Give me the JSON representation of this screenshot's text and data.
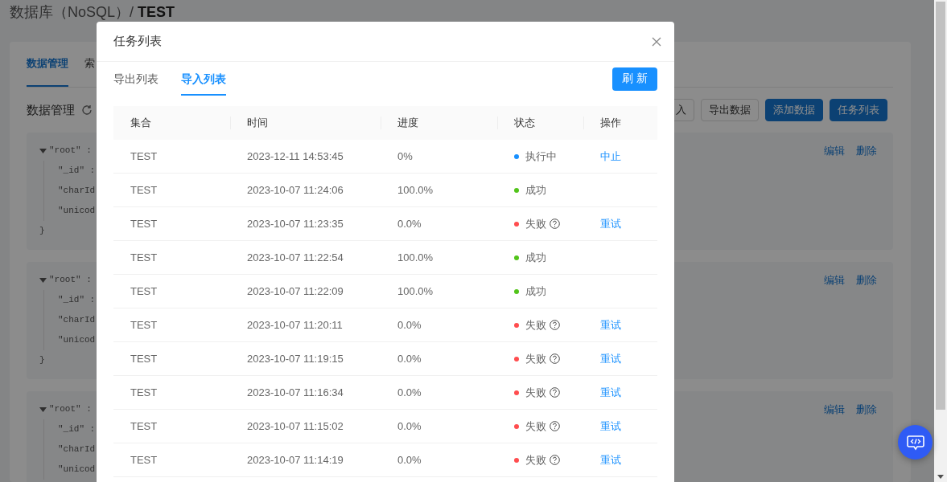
{
  "page": {
    "breadcrumb": "数据库（NoSQL）/ **TEST**",
    "tabs": [
      {
        "label": "数据管理",
        "selected": true
      },
      {
        "label": "索",
        "selected": false
      }
    ],
    "section_title": "数据管理",
    "toolbar_buttons": [
      {
        "label": "入",
        "kind": "default"
      },
      {
        "label": "导出数据",
        "kind": "default"
      },
      {
        "label": "添加数据",
        "kind": "primary"
      },
      {
        "label": "任务列表",
        "kind": "primary"
      }
    ],
    "records": [
      {
        "root": "\"root\" :",
        "expanded": true,
        "fields": [
          "\"_id\" :",
          "\"charId",
          "\"unicod"
        ],
        "closing": "}",
        "actions": [
          "编辑",
          "删除"
        ]
      },
      {
        "root": "\"root\" :",
        "expanded": true,
        "fields": [
          "\"_id\" :",
          "\"charId",
          "\"unicod"
        ],
        "closing": "}",
        "actions": [
          "编辑",
          "删除"
        ]
      },
      {
        "root": "\"root\" :",
        "expanded": true,
        "fields": [
          "\"_id\" :",
          "\"charId",
          "\"unicod"
        ],
        "actions": [
          "编辑",
          "删除"
        ]
      }
    ]
  },
  "dialog": {
    "title": "任务列表",
    "tabs": [
      {
        "label": "导出列表",
        "selected": false
      },
      {
        "label": "导入列表",
        "selected": true
      }
    ],
    "refresh_button": "刷 新",
    "table": {
      "columns": [
        "集合",
        "时间",
        "进度",
        "状态",
        "操作"
      ],
      "rows": [
        {
          "collection": "TEST",
          "time": "2023-12-11 14:53:45",
          "progress": "0%",
          "status": {
            "text": "执行中",
            "kind": "running",
            "color": "#1890ff"
          },
          "action": "中止"
        },
        {
          "collection": "TEST",
          "time": "2023-10-07 11:24:06",
          "progress": "100.0%",
          "status": {
            "text": "成功",
            "kind": "success",
            "color": "#52c41a"
          }
        },
        {
          "collection": "TEST",
          "time": "2023-10-07 11:23:35",
          "progress": "0.0%",
          "status": {
            "text": "失败",
            "kind": "failed",
            "color": "#ff4d4f"
          },
          "action": "重试"
        },
        {
          "collection": "TEST",
          "time": "2023-10-07 11:22:54",
          "progress": "100.0%",
          "status": {
            "text": "成功",
            "kind": "success",
            "color": "#52c41a"
          }
        },
        {
          "collection": "TEST",
          "time": "2023-10-07 11:22:09",
          "progress": "100.0%",
          "status": {
            "text": "成功",
            "kind": "success",
            "color": "#52c41a"
          }
        },
        {
          "collection": "TEST",
          "time": "2023-10-07 11:20:11",
          "progress": "0.0%",
          "status": {
            "text": "失败",
            "kind": "failed",
            "color": "#ff4d4f"
          },
          "action": "重试"
        },
        {
          "collection": "TEST",
          "time": "2023-10-07 11:19:15",
          "progress": "0.0%",
          "status": {
            "text": "失败",
            "kind": "failed",
            "color": "#ff4d4f"
          },
          "action": "重试"
        },
        {
          "collection": "TEST",
          "time": "2023-10-07 11:16:34",
          "progress": "0.0%",
          "status": {
            "text": "失败",
            "kind": "failed",
            "color": "#ff4d4f"
          },
          "action": "重试"
        },
        {
          "collection": "TEST",
          "time": "2023-10-07 11:15:02",
          "progress": "0.0%",
          "status": {
            "text": "失败",
            "kind": "failed",
            "color": "#ff4d4f"
          },
          "action": "重试"
        },
        {
          "collection": "TEST",
          "time": "2023-10-07 11:14:19",
          "progress": "0.0%",
          "status": {
            "text": "失败",
            "kind": "failed",
            "color": "#ff4d4f"
          },
          "action": "重试"
        }
      ]
    }
  }
}
